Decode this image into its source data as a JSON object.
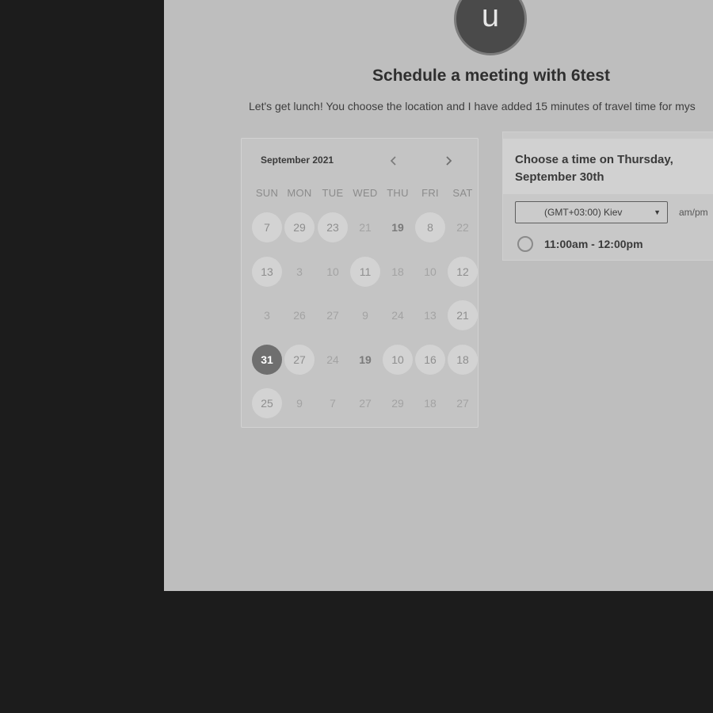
{
  "header": {
    "avatar_letter": "u",
    "title": "Schedule a meeting with 6test",
    "subtitle": "Let's get lunch! You choose the location and I have added 15 minutes of travel time for mys"
  },
  "calendar": {
    "month_label": "September 2021",
    "prev_icon": "chevron-left-icon",
    "next_icon": "chevron-right-icon",
    "weekdays": [
      "SUN",
      "MON",
      "TUE",
      "WED",
      "THU",
      "FRI",
      "SAT"
    ],
    "weeks": [
      [
        {
          "label": "7",
          "state": "available"
        },
        {
          "label": "29",
          "state": "available"
        },
        {
          "label": "23",
          "state": "available"
        },
        {
          "label": "21",
          "state": "disabled"
        },
        {
          "label": "19",
          "state": "bold"
        },
        {
          "label": "8",
          "state": "available"
        },
        {
          "label": "22",
          "state": "disabled"
        }
      ],
      [
        {
          "label": "13",
          "state": "available"
        },
        {
          "label": "3",
          "state": "disabled"
        },
        {
          "label": "10",
          "state": "disabled"
        },
        {
          "label": "11",
          "state": "available"
        },
        {
          "label": "18",
          "state": "disabled"
        },
        {
          "label": "10",
          "state": "disabled"
        },
        {
          "label": "12",
          "state": "available"
        }
      ],
      [
        {
          "label": "3",
          "state": "disabled"
        },
        {
          "label": "26",
          "state": "disabled"
        },
        {
          "label": "27",
          "state": "disabled"
        },
        {
          "label": "9",
          "state": "disabled"
        },
        {
          "label": "24",
          "state": "disabled"
        },
        {
          "label": "13",
          "state": "disabled"
        },
        {
          "label": "21",
          "state": "available"
        }
      ],
      [
        {
          "label": "31",
          "state": "selected"
        },
        {
          "label": "27",
          "state": "available"
        },
        {
          "label": "24",
          "state": "disabled"
        },
        {
          "label": "19",
          "state": "bold"
        },
        {
          "label": "10",
          "state": "available"
        },
        {
          "label": "16",
          "state": "available"
        },
        {
          "label": "18",
          "state": "available"
        }
      ],
      [
        {
          "label": "25",
          "state": "available"
        },
        {
          "label": "9",
          "state": "disabled"
        },
        {
          "label": "7",
          "state": "disabled"
        },
        {
          "label": "27",
          "state": "disabled"
        },
        {
          "label": "29",
          "state": "disabled"
        },
        {
          "label": "18",
          "state": "disabled"
        },
        {
          "label": "27",
          "state": "disabled"
        }
      ]
    ]
  },
  "time_panel": {
    "header": "Choose a time on Thursday, September 30th",
    "timezone": "(GMT+03:00) Kiev",
    "timezone_icon": "caret-down-icon",
    "format_label": "am/pm",
    "slots": [
      "11:00am - 12:00pm"
    ]
  }
}
